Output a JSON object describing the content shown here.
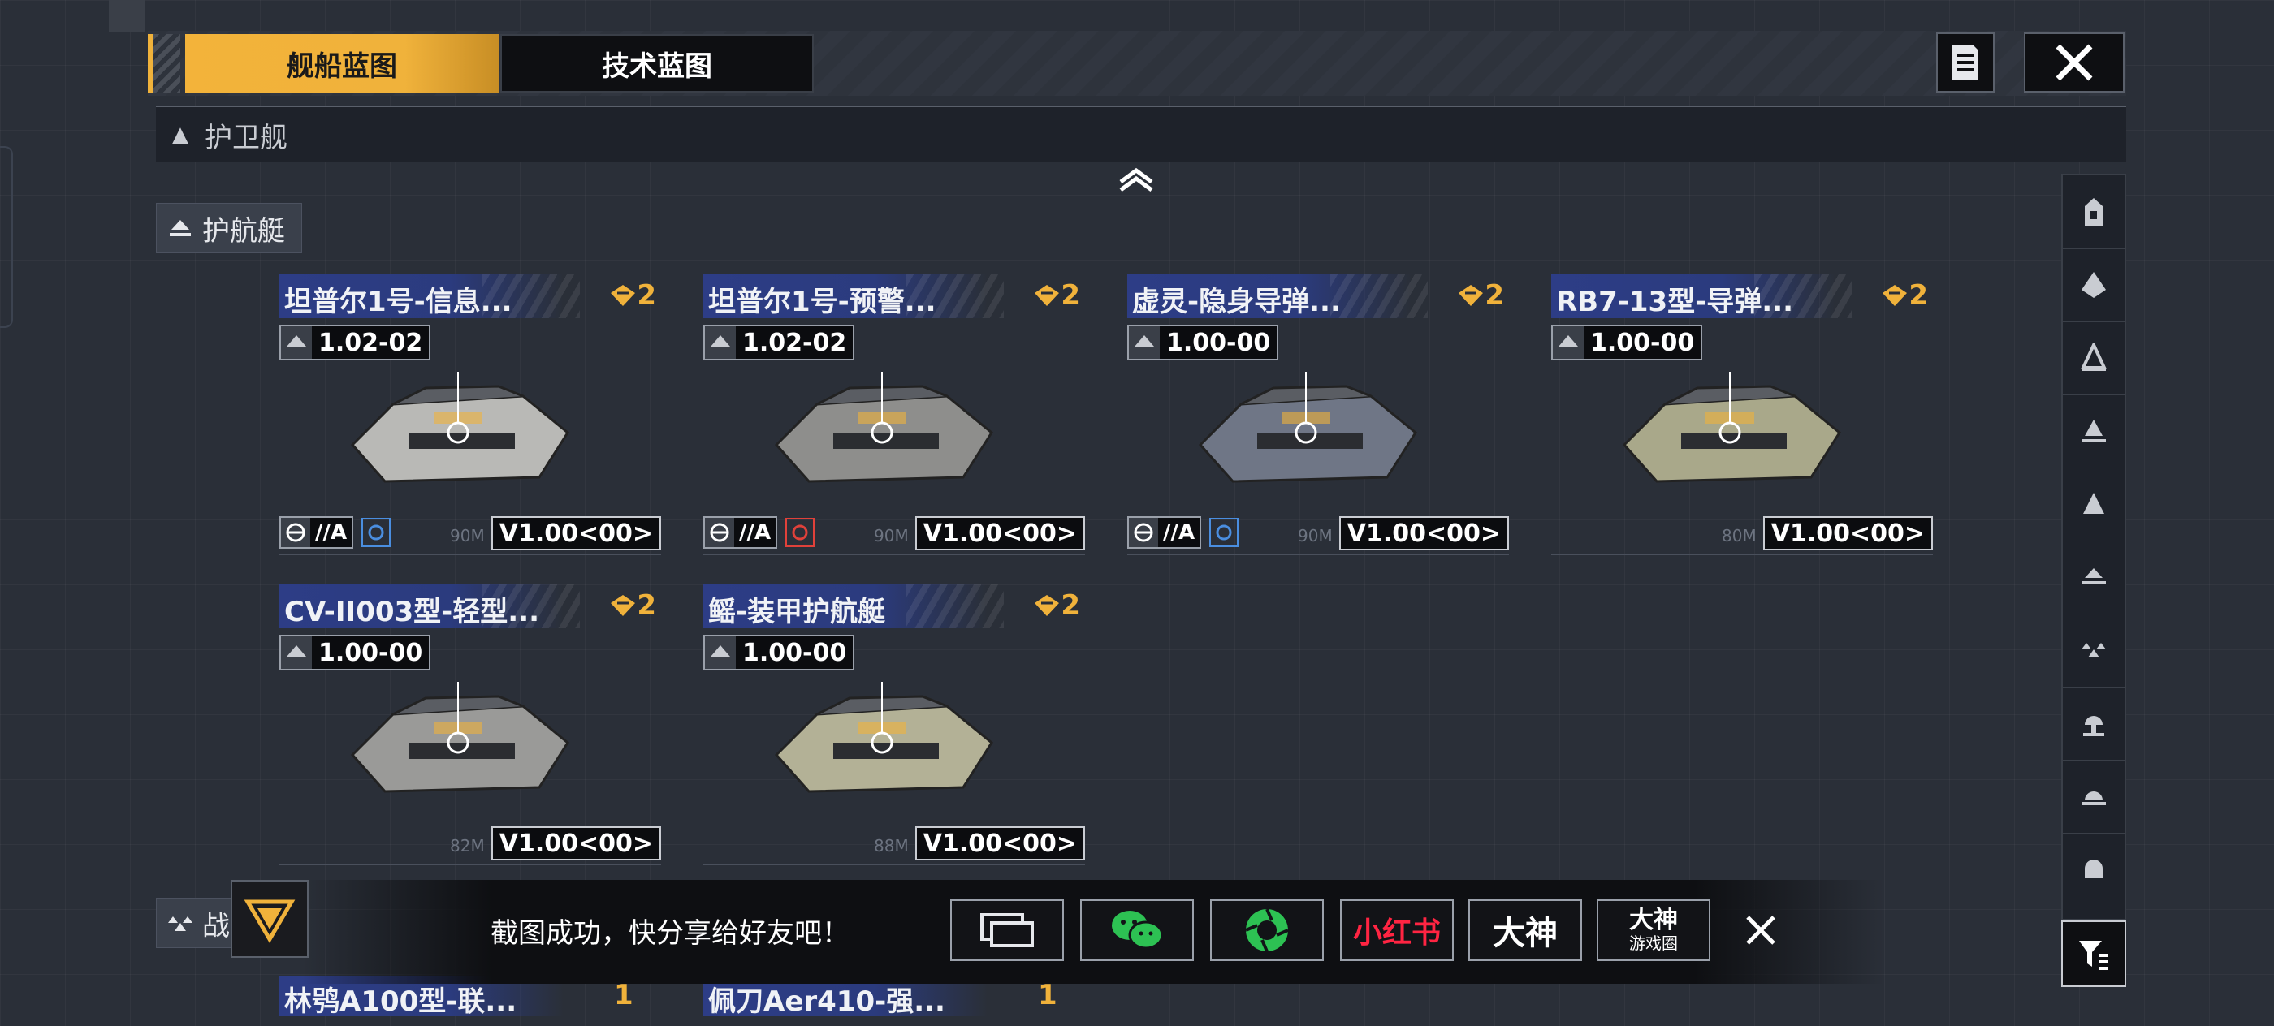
{
  "tabs": {
    "ship_blueprint": "舰船蓝图",
    "tech_blueprint": "技术蓝图"
  },
  "section": {
    "escort": "护卫舰",
    "corvette": "护航艇",
    "battle": "战"
  },
  "cards": [
    {
      "title": "坦普尔1号-信息...",
      "tier": "2",
      "version": "1.02-02",
      "tag": "//A",
      "distance": "90M",
      "v": "V1.00<00>"
    },
    {
      "title": "坦普尔1号-预警...",
      "tier": "2",
      "version": "1.02-02",
      "tag": "//A",
      "distance": "90M",
      "v": "V1.00<00>"
    },
    {
      "title": "虚灵-隐身导弹...",
      "tier": "2",
      "version": "1.00-00",
      "tag": "//A",
      "distance": "90M",
      "v": "V1.00<00>"
    },
    {
      "title": "RB7-13型-导弹...",
      "tier": "2",
      "version": "1.00-00",
      "tag": "",
      "distance": "80M",
      "v": "V1.00<00>"
    },
    {
      "title": "CV-II003型-轻型...",
      "tier": "2",
      "version": "1.00-00",
      "tag": "",
      "distance": "82M",
      "v": "V1.00<00>"
    },
    {
      "title": "鳐-装甲护航艇",
      "tier": "2",
      "version": "1.00-00",
      "tag": "",
      "distance": "88M",
      "v": "V1.00<00>"
    }
  ],
  "bottom_cards": [
    {
      "title": "林鸮A100型-联...",
      "tier": "1"
    },
    {
      "title": "佩刀Aer410-强...",
      "tier": "1"
    }
  ],
  "share": {
    "message": "截图成功，快分享给好友吧！",
    "xiaohongshu": "小红书",
    "dashen": "大神",
    "dashen_circle_top": "大神",
    "dashen_circle_bottom": "游戏圈"
  },
  "colors": {
    "accent": "#f0b23b",
    "title_bg": "#2d3d86",
    "panel": "#1e222a"
  },
  "icons": [
    "document-icon",
    "close-icon",
    "filter-icon",
    "share-screen-icon",
    "wechat-icon",
    "moments-icon"
  ]
}
